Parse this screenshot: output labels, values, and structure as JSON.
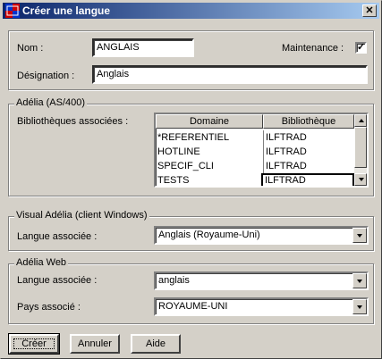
{
  "window": {
    "title": "Créer une langue"
  },
  "general": {
    "nom_label": "Nom :",
    "nom_value": "ANGLAIS",
    "maintenance_label": "Maintenance :",
    "maintenance_checked": true,
    "designation_label": "Désignation :",
    "designation_value": "Anglais"
  },
  "adelia_as400": {
    "group_title": "Adélia (AS/400)",
    "bibliotheques_label": "Bibliothèques associées :",
    "columns": [
      "Domaine",
      "Bibliothèque"
    ],
    "rows": [
      {
        "domaine": "*REFERENTIEL",
        "bibliotheque": "ILFTRAD"
      },
      {
        "domaine": "HOTLINE",
        "bibliotheque": "ILFTRAD"
      },
      {
        "domaine": "SPECIF_CLI",
        "bibliotheque": "ILFTRAD"
      },
      {
        "domaine": "TESTS",
        "bibliotheque": "ILFTRAD"
      }
    ]
  },
  "visual_adelia": {
    "group_title": "Visual Adélia (client Windows)",
    "langue_label": "Langue associée :",
    "langue_value": "Anglais (Royaume-Uni)"
  },
  "adelia_web": {
    "group_title": "Adélia Web",
    "langue_label": "Langue associée :",
    "langue_value": "anglais",
    "pays_label": "Pays associé :",
    "pays_value": "ROYAUME-UNI"
  },
  "buttons": {
    "creer": "Créer",
    "annuler": "Annuler",
    "aide": "Aide"
  }
}
